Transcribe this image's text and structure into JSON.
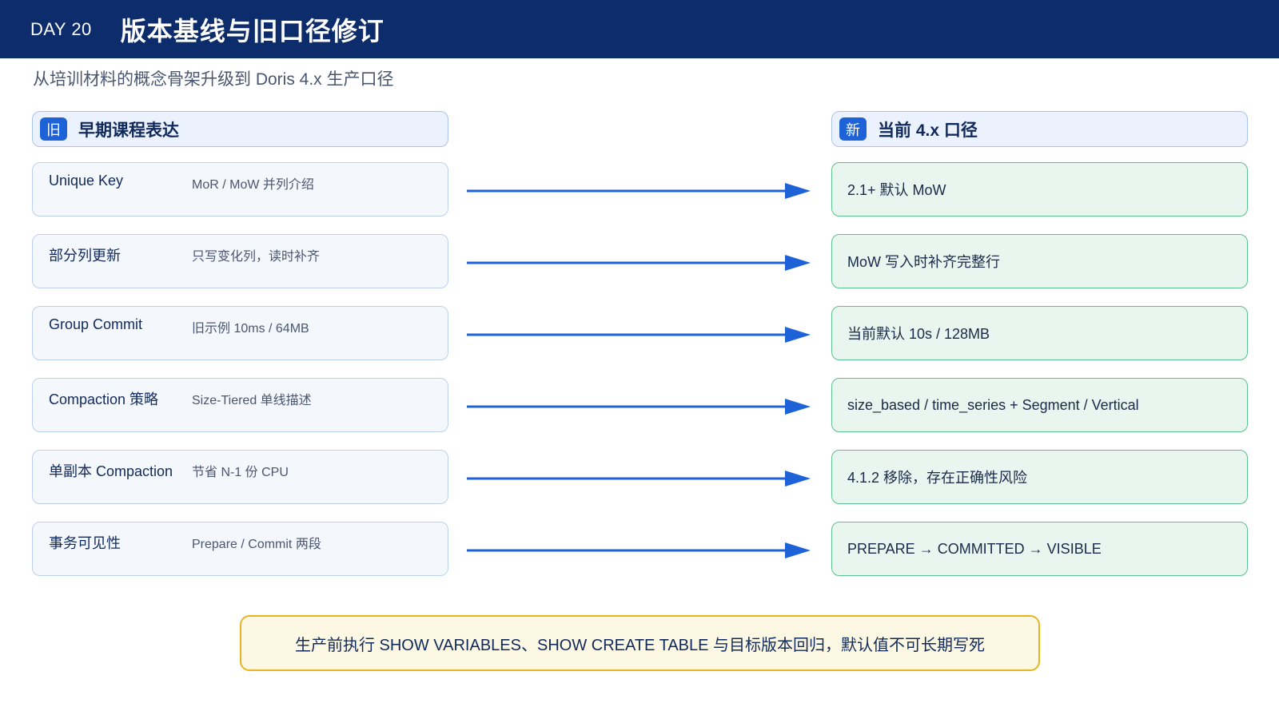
{
  "header": {
    "day": "DAY 20",
    "title": "版本基线与旧口径修订"
  },
  "subtitle": "从培训材料的概念骨架升级到 Doris 4.x 生产口径",
  "old_column": {
    "badge": "旧",
    "title": "早期课程表达"
  },
  "new_column": {
    "badge": "新",
    "title": "当前 4.x 口径"
  },
  "rows": [
    {
      "name": "Unique Key",
      "old": "MoR / MoW 并列介绍",
      "new": "2.1+ 默认 MoW"
    },
    {
      "name": "部分列更新",
      "old": "只写变化列，读时补齐",
      "new": "MoW 写入时补齐完整行"
    },
    {
      "name": "Group Commit",
      "old": "旧示例 10ms / 64MB",
      "new": "当前默认 10s / 128MB"
    },
    {
      "name": "Compaction 策略",
      "old": "Size-Tiered 单线描述",
      "new": "size_based / time_series + Segment / Vertical"
    },
    {
      "name": "单副本 Compaction",
      "old": "节省 N-1 份 CPU",
      "new": "4.1.2 移除，存在正确性风险"
    },
    {
      "name": "事务可见性",
      "old": "Prepare / Commit 两段",
      "new": "PREPARE → COMMITTED → VISIBLE"
    }
  ],
  "note": "生产前执行 SHOW VARIABLES、SHOW CREATE TABLE 与目标版本回归，默认值不可长期写死",
  "colors": {
    "header_bg": "#0d2c6b",
    "badge": "#1e62d8",
    "arrow": "#1e62d8",
    "old_border": "#bcd0ef",
    "new_border": "#5cc08f",
    "note_border": "#e8b420"
  }
}
